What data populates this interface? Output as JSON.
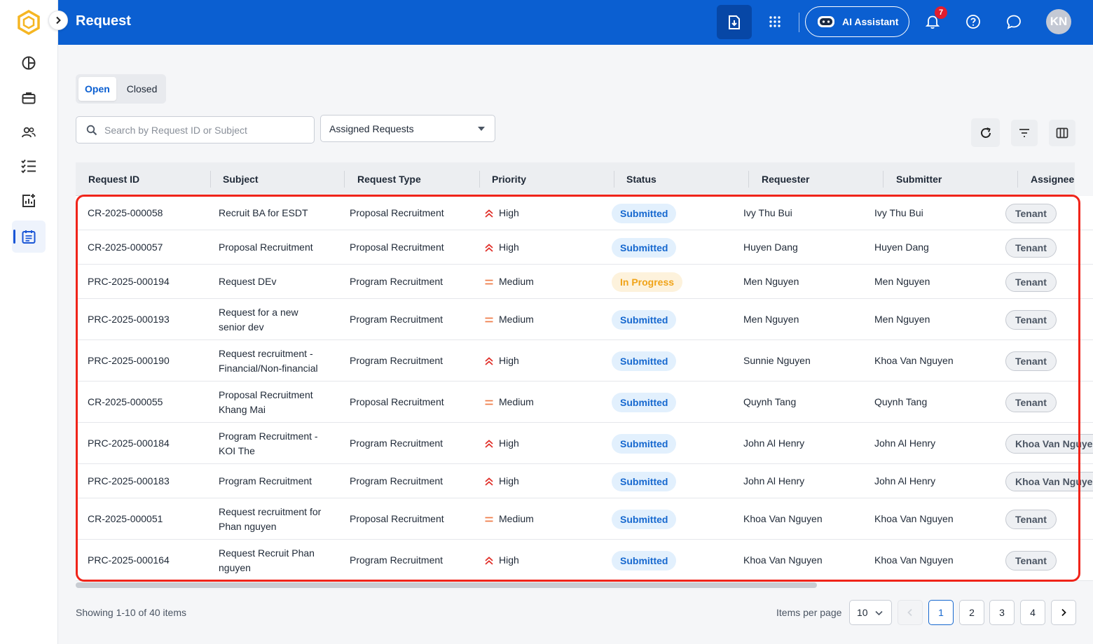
{
  "header": {
    "title": "Request",
    "ai_assistant_label": "AI Assistant",
    "notification_count": "7",
    "avatar_initials": "KN"
  },
  "sidebar": {
    "items": [
      {
        "icon": "pie-chart-icon"
      },
      {
        "icon": "briefcase-icon"
      },
      {
        "icon": "users-icon"
      },
      {
        "icon": "checklist-icon"
      },
      {
        "icon": "chart-add-icon"
      },
      {
        "icon": "calendar-list-icon",
        "active": true
      }
    ]
  },
  "tabs": [
    {
      "label": "Open",
      "active": true
    },
    {
      "label": "Closed",
      "active": false
    }
  ],
  "search": {
    "placeholder": "Search by Request ID or Subject",
    "value": ""
  },
  "filter_select": {
    "value": "Assigned Requests"
  },
  "table": {
    "columns": [
      "Request ID",
      "Subject",
      "Request Type",
      "Priority",
      "Status",
      "Requester",
      "Submitter",
      "Assignee"
    ],
    "rows": [
      {
        "id": "CR-2025-000058",
        "subject": [
          "Recruit BA for ESDT"
        ],
        "type": "Proposal Recruitment",
        "priority": "High",
        "status": "Submitted",
        "requester": "Ivy Thu Bui",
        "submitter": "Ivy Thu Bui",
        "assignee": "Tenant"
      },
      {
        "id": "CR-2025-000057",
        "subject": [
          "Proposal Recruitment"
        ],
        "type": "Proposal Recruitment",
        "priority": "High",
        "status": "Submitted",
        "requester": "Huyen Dang",
        "submitter": "Huyen Dang",
        "assignee": "Tenant"
      },
      {
        "id": "PRC-2025-000194",
        "subject": [
          "Request DEv"
        ],
        "type": "Program Recruitment",
        "priority": "Medium",
        "status": "In Progress",
        "requester": "Men Nguyen",
        "submitter": "Men Nguyen",
        "assignee": "Tenant"
      },
      {
        "id": "PRC-2025-000193",
        "subject": [
          "Request for a new",
          "senior dev"
        ],
        "type": "Program Recruitment",
        "priority": "Medium",
        "status": "Submitted",
        "requester": "Men Nguyen",
        "submitter": "Men Nguyen",
        "assignee": "Tenant"
      },
      {
        "id": "PRC-2025-000190",
        "subject": [
          "Request recruitment -",
          "Financial/Non-financial"
        ],
        "type": "Program Recruitment",
        "priority": "High",
        "status": "Submitted",
        "requester": "Sunnie Nguyen",
        "submitter": "Khoa Van Nguyen",
        "assignee": "Tenant"
      },
      {
        "id": "CR-2025-000055",
        "subject": [
          "Proposal Recruitment",
          "Khang Mai"
        ],
        "type": "Proposal Recruitment",
        "priority": "Medium",
        "status": "Submitted",
        "requester": "Quynh Tang",
        "submitter": "Quynh Tang",
        "assignee": "Tenant"
      },
      {
        "id": "PRC-2025-000184",
        "subject": [
          "Program Recruitment -",
          "KOI The"
        ],
        "type": "Program Recruitment",
        "priority": "High",
        "status": "Submitted",
        "requester": "John Al Henry",
        "submitter": "John Al Henry",
        "assignee": "Khoa Van Nguyen"
      },
      {
        "id": "PRC-2025-000183",
        "subject": [
          "Program Recruitment"
        ],
        "type": "Program Recruitment",
        "priority": "High",
        "status": "Submitted",
        "requester": "John Al Henry",
        "submitter": "John Al Henry",
        "assignee": "Khoa Van Nguyen"
      },
      {
        "id": "CR-2025-000051",
        "subject": [
          "Request recruitment for",
          "Phan nguyen"
        ],
        "type": "Proposal Recruitment",
        "priority": "Medium",
        "status": "Submitted",
        "requester": "Khoa Van Nguyen",
        "submitter": "Khoa Van Nguyen",
        "assignee": "Tenant"
      },
      {
        "id": "PRC-2025-000164",
        "subject": [
          "Request Recruit Phan",
          "nguyen"
        ],
        "type": "Program Recruitment",
        "priority": "High",
        "status": "Submitted",
        "requester": "Khoa Van Nguyen",
        "submitter": "Khoa Van Nguyen",
        "assignee": "Tenant"
      }
    ]
  },
  "footer": {
    "showing": "Showing 1-10 of 40 items",
    "items_per_page_label": "Items per page",
    "items_per_page_value": "10",
    "pages": [
      "1",
      "2",
      "3",
      "4"
    ],
    "current_page": "1"
  },
  "colors": {
    "header_bg": "#0b5fd1",
    "high_priority": "#e0302a",
    "medium_priority": "#ef7d4a",
    "submitted": "#1668cf",
    "in_progress": "#f0a318",
    "highlight_frame": "#f0241a"
  }
}
